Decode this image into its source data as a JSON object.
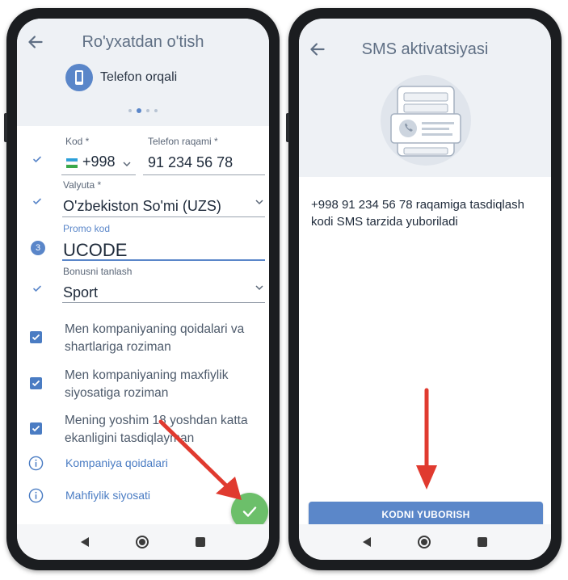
{
  "left_screen": {
    "title": "Ro'yxatdan o'tish",
    "method_label": "Telefon orqali",
    "fields": {
      "code_label": "Kod *",
      "code_value": "+998",
      "phone_label": "Telefon raqami *",
      "phone_value": "91 234 56 78",
      "currency_label": "Valyuta *",
      "currency_value": "O'zbekiston So'mi (UZS)",
      "promo_label": "Promo kod",
      "promo_value": "UCODE",
      "promo_step": "3",
      "bonus_label": "Bonusni tanlash",
      "bonus_value": "Sport"
    },
    "checkboxes": [
      {
        "text": "Men kompaniyaning qoidalari va shartlariga roziman",
        "checked": true
      },
      {
        "text": "Men kompaniyaning maxfiylik siyosatiga roziman",
        "checked": true
      },
      {
        "text": "Mening yoshim 18 yoshdan katta ekanligini tasdiqlayman",
        "checked": true
      }
    ],
    "links": {
      "rules": "Kompaniya qoidalari",
      "privacy": "Mahfiylik siyosati"
    },
    "fab_icon": "check-icon"
  },
  "right_screen": {
    "title": "SMS aktivatsiyasi",
    "message": "+998 91 234 56 78 raqamiga  tasdiqlash\n kodi SMS tarzida yuboriladi",
    "send_button": "KODNI YUBORISH"
  },
  "colors": {
    "accent": "#5a86c9",
    "fab": "#6cbf6a",
    "annotation_arrow": "#e03a2f"
  }
}
